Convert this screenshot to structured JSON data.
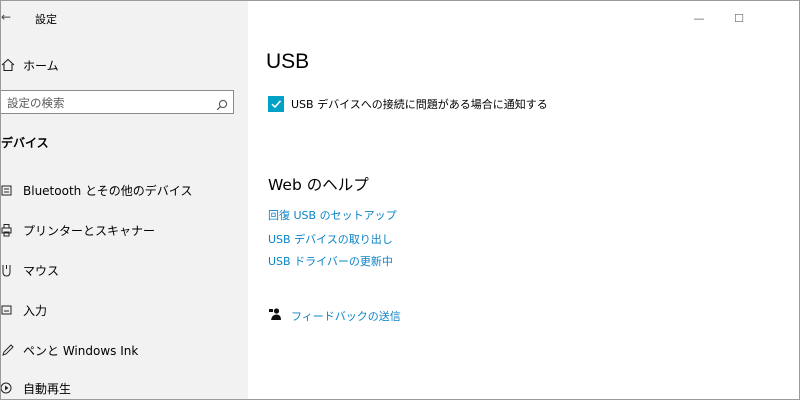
{
  "window": {
    "title": "設定",
    "minimize_glyph": "—",
    "maximize_glyph": "☐"
  },
  "sidebar": {
    "home_label": "ホーム",
    "search_placeholder": "設定の検索",
    "section_title": "デバイス",
    "items": [
      {
        "label": "Bluetooth とその他のデバイス",
        "icon": "keyboard-icon"
      },
      {
        "label": "プリンターとスキャナー",
        "icon": "printer-icon"
      },
      {
        "label": "マウス",
        "icon": "mouse-icon"
      },
      {
        "label": "入力",
        "icon": "keyboard-input-icon"
      },
      {
        "label": "ペンと Windows Ink",
        "icon": "pen-icon"
      },
      {
        "label": "自動再生",
        "icon": "autoplay-icon"
      }
    ]
  },
  "main": {
    "page_title": "USB",
    "notify_checkbox": {
      "checked": true,
      "label": "USB デバイスへの接続に問題がある場合に通知する"
    },
    "help_heading": "Web のヘルプ",
    "help_links": [
      "回復 USB のセットアップ",
      "USB デバイスの取り出し",
      "USB ドライバーの更新中"
    ],
    "feedback_label": "フィードバックの送信"
  },
  "colors": {
    "accent": "#00a1c6",
    "link": "#0a84c6",
    "sidebar_bg": "#f2f2f2"
  }
}
